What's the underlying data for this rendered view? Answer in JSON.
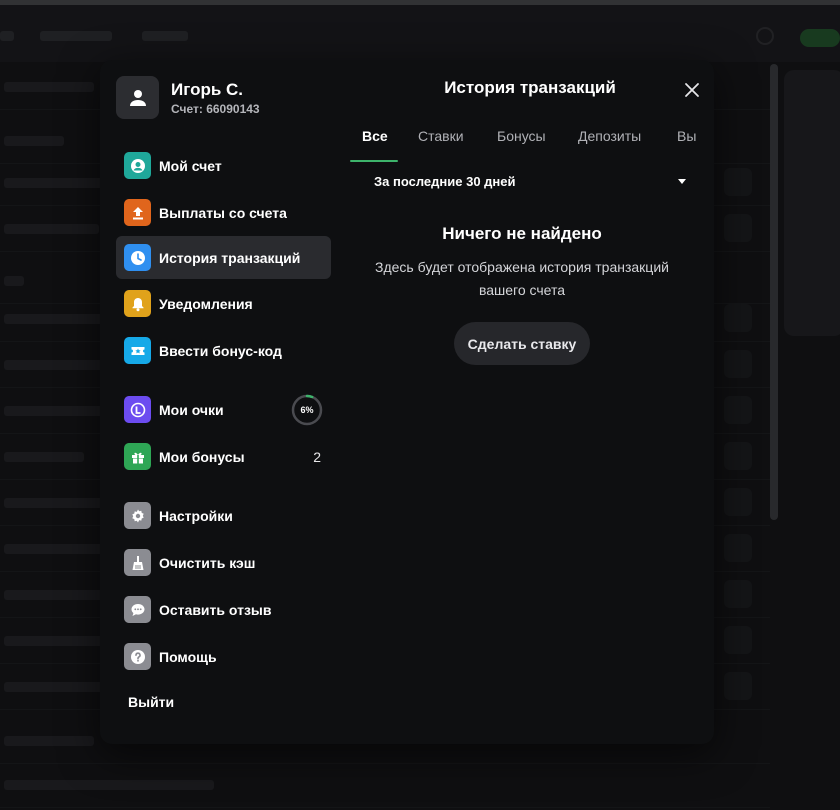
{
  "profile": {
    "name": "Игорь С.",
    "account": "Счет: 66090143",
    "icon": "user-icon"
  },
  "menu": {
    "my_account": {
      "label": "Мой счет",
      "icon": "account-icon",
      "color": "#1fa89a"
    },
    "withdrawals": {
      "label": "Выплаты со счета",
      "icon": "upload-icon",
      "color": "#e0651c"
    },
    "history": {
      "label": "История транзакций",
      "icon": "clock-icon",
      "color": "#2f8ff0"
    },
    "notifications": {
      "label": "Уведомления",
      "icon": "bell-icon",
      "color": "#e0a21b"
    },
    "bonus_code": {
      "label": "Ввести бонус-код",
      "icon": "ticket-icon",
      "color": "#16a9e8"
    },
    "points": {
      "label": "Мои очки",
      "icon": "points-icon",
      "color": "#6c4cf0",
      "progress_text": "6%",
      "progress": 0.06
    },
    "bonuses": {
      "label": "Мои бонусы",
      "icon": "gift-icon",
      "color": "#2ea655",
      "count": "2"
    },
    "settings": {
      "label": "Настройки",
      "icon": "gear-icon",
      "color": "#8b8c92"
    },
    "clear_cache": {
      "label": "Очистить кэш",
      "icon": "broom-icon",
      "color": "#8b8c92"
    },
    "feedback": {
      "label": "Оставить отзыв",
      "icon": "chat-icon",
      "color": "#8b8c92"
    },
    "help": {
      "label": "Помощь",
      "icon": "help-icon",
      "color": "#8b8c92"
    },
    "logout": {
      "label": "Выйти"
    }
  },
  "main": {
    "title": "История транзакций",
    "tabs": [
      "Все",
      "Ставки",
      "Бонусы",
      "Депозиты",
      "Вы"
    ],
    "filter": "За последние 30 дней",
    "empty_title": "Ничего не найдено",
    "empty_desc": "Здесь будет отображена история транзакций вашего счета",
    "cta": "Сделать ставку"
  },
  "colors": {
    "accent": "#3db36b",
    "modal_bg": "#0e0f11"
  }
}
